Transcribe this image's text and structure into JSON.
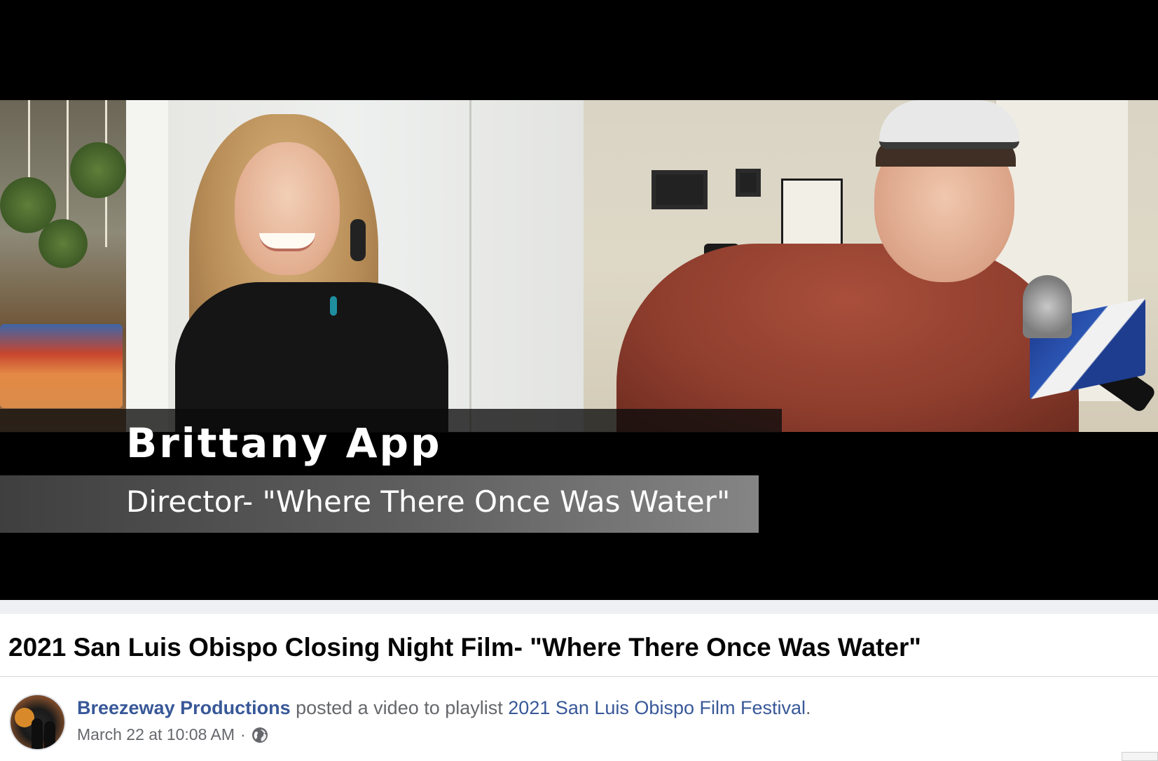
{
  "video": {
    "lower_third": {
      "name": "Brittany App",
      "role": "Director- \"Where There Once Was Water\""
    }
  },
  "post": {
    "title": "2021 San Luis Obispo Closing Night Film- \"Where There Once Was Water\"",
    "author": "Breezeway Productions",
    "action_text": " posted a video to playlist ",
    "playlist": "2021 San Luis Obispo Film Festival",
    "period": ".",
    "timestamp": "March 22 at 10:08 AM",
    "separator": "·",
    "privacy_icon": "globe-icon"
  },
  "colors": {
    "link": "#385898",
    "secondary_text": "#65676b",
    "title_text": "#050505"
  }
}
